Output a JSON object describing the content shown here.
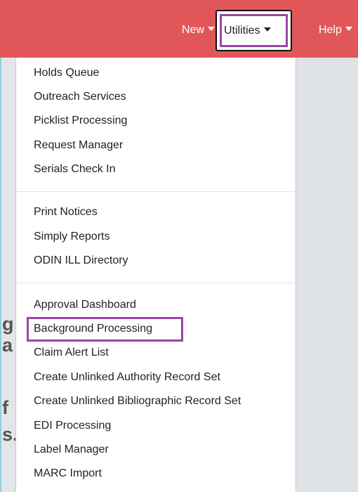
{
  "navbar": {
    "new_label": "New",
    "utilities_label": "Utilities",
    "help_label": "Help",
    "color": "#e15759"
  },
  "highlight_color": "#9b45a8",
  "page_behind": {
    "fragments": [
      "g",
      "a",
      "f",
      "s."
    ]
  },
  "utilities_menu": {
    "groups": [
      [
        "Holds Queue",
        "Outreach Services",
        "Picklist Processing",
        "Request Manager",
        "Serials Check In"
      ],
      [
        "Print Notices",
        "Simply Reports",
        "ODIN ILL Directory"
      ],
      [
        "Approval Dashboard",
        "Background Processing",
        "Claim Alert List",
        "Create Unlinked Authority Record Set",
        "Create Unlinked Bibliographic Record Set",
        "EDI Processing",
        "Label Manager",
        "MARC Import"
      ]
    ],
    "highlighted_item": "Background Processing"
  }
}
